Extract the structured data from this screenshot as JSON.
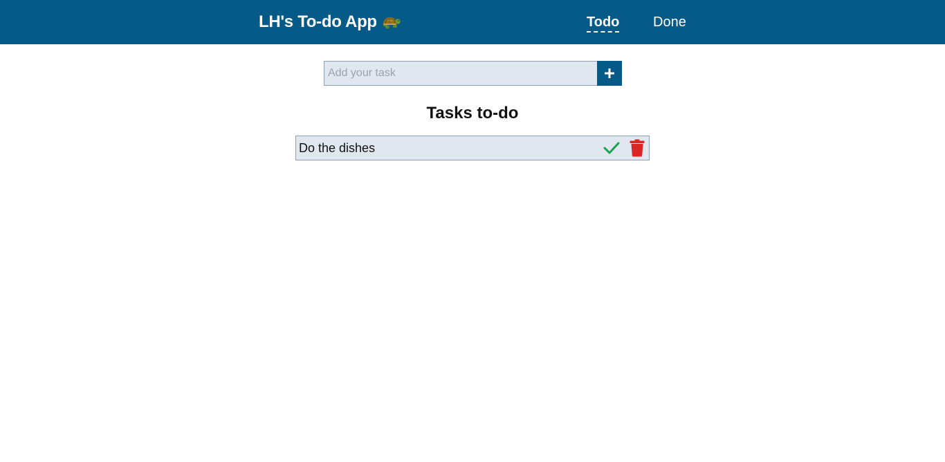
{
  "navbar": {
    "brand_title": "LH's To-do App",
    "brand_icon": "turtle-icon",
    "links": [
      {
        "label": "Todo",
        "active": true
      },
      {
        "label": "Done",
        "active": false
      }
    ],
    "background_color": "#065a87"
  },
  "add_task": {
    "placeholder": "Add your task",
    "value": "",
    "button_icon": "plus-icon"
  },
  "main": {
    "section_title": "Tasks to-do",
    "tasks": [
      {
        "label": "Do the dishes",
        "complete_icon": "checkmark-icon",
        "delete_icon": "trash-icon"
      }
    ]
  },
  "colors": {
    "accent": "#065a87",
    "complete": "#16a34a",
    "delete": "#dc2626",
    "task_bg": "#e1e7ef"
  }
}
